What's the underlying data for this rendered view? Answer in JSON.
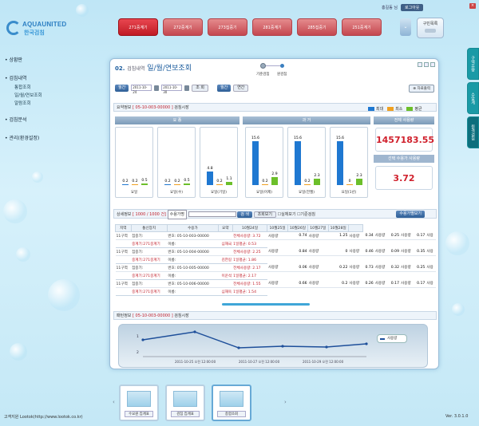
{
  "logo": {
    "line1": "AQUAUNITED",
    "line2": "한국검침"
  },
  "top_links": {
    "user": "홍길동 님",
    "logout": "로그아웃"
  },
  "top_tabs": [
    "271중계기",
    "272중계기",
    "273집중기",
    "281중계기",
    "285집중기",
    "251중계기"
  ],
  "menu_button": "구민목록",
  "nav": {
    "title1": "상황판",
    "title2": "검침내역",
    "sub": [
      "통합조회",
      "일/월/연보조회",
      "알람조회"
    ],
    "title3": "검침분석",
    "title4": "관리(환경설정)"
  },
  "right_tabs": [
    "구역유량",
    "수압계",
    "원격검침"
  ],
  "panel": {
    "title_num": "02.",
    "title_small": "검침내역",
    "title_main": "일/월/연보조회",
    "step1": "기준검침",
    "step2": "원검침",
    "filters": {
      "label": "월간",
      "from": "2011-10-24",
      "to": "2011-10-30",
      "search": "조 회",
      "tab1": "월간",
      "tab2": "연간"
    },
    "export": "자료출력",
    "summary_header": {
      "label": "요약정보",
      "code": "[ 05-10-003-00000 ]",
      "suffix": "검침시장"
    },
    "legend": [
      "최대",
      "최소",
      "평균"
    ],
    "section_labels": {
      "left": "요 종",
      "mid": "과 거",
      "right": "전체 사용량"
    },
    "total_usage": "1457183.55",
    "month_label": "선택 수용가 사용량",
    "month_value": "3.72",
    "detail_header": {
      "label": "상세정보",
      "count": "[ 1000 / 1000 건]",
      "filter": "수용가명",
      "btn": "검 색",
      "btn2": "조회보기",
      "check1": "실체보기",
      "check2": "기준검침",
      "list_btn": "수용가별보기"
    },
    "detail_cols": [
      "지역",
      "통신장치",
      "수용가",
      "요약",
      "10월24일",
      "10월25일",
      "10월26일",
      "10월27일",
      "10월28일",
      ""
    ],
    "detail_rows": [
      {
        "region": "11구역",
        "dev": [
          "집중기:",
          "중계기:271중계기"
        ],
        "cust": [
          "번호: 05-10-003-00000",
          "이름:"
        ],
        "name": "심재국",
        "sum": [
          "전체사용량: 3.72",
          "1일평균: 0.53"
        ],
        "v": [
          [
            "사용량",
            "0.74"
          ],
          [
            "사용량",
            "1.25"
          ],
          [
            "사용량",
            "0.34"
          ],
          [
            "사용량",
            "0.25"
          ],
          [
            "사용량",
            "0.17"
          ]
        ]
      },
      {
        "region": "11구역",
        "dev": [
          "집중기:",
          "중계기:271중계기"
        ],
        "cust": [
          "번호: 05-10-004-00000",
          "이름:"
        ],
        "name": "김한길",
        "sum": [
          "전체사용량: 2.25",
          "1일평균: 1.86"
        ],
        "v": [
          [
            "사용량",
            "0.84"
          ],
          [
            "사용량",
            "0"
          ],
          [
            "사용량",
            "0.46"
          ],
          [
            "사용량",
            "0.09"
          ],
          [
            "사용량",
            "0.35"
          ]
        ]
      },
      {
        "region": "11구역",
        "dev": [
          "집중기:",
          "중계기:271중계기"
        ],
        "cust": [
          "번호: 05-10-005-00000",
          "이름:"
        ],
        "name": "이운석",
        "sum": [
          "전체사용량: 2.17",
          "1일평균: 2.17"
        ],
        "v": [
          [
            "사용량",
            "0.06"
          ],
          [
            "사용량",
            "0.22"
          ],
          [
            "사용량",
            "0.73"
          ],
          [
            "사용량",
            "0.32"
          ],
          [
            "사용량",
            "0.25"
          ]
        ]
      },
      {
        "region": "11구역",
        "dev": [
          "집중기:",
          "중계기:271중계기"
        ],
        "cust": [
          "번호: 05-10-006-00000",
          "이름:"
        ],
        "name": "심재욱",
        "sum": [
          "전체사용량: 1.55",
          "1일평균: 1.54"
        ],
        "v": [
          [
            "사용량",
            "0.66"
          ],
          [
            "사용량",
            "0.2"
          ],
          [
            "사용량",
            "0.26"
          ],
          [
            "사용량",
            "0.17"
          ],
          [
            "사용량",
            "0.17"
          ]
        ]
      }
    ],
    "row_extra": "사용",
    "trend_header": {
      "label": "패턴정보",
      "code": "[ 05-10-003-00000 ]",
      "suffix": "검침시장"
    },
    "trend_legend": "사용량",
    "trend_x": [
      "2011-10-25 오전 12:00:00",
      "2011-10-27 오전 12:00:00",
      "2011-10-29 오전 12:00:00"
    ],
    "trend_y": [
      "1",
      "2"
    ]
  },
  "chart_data": {
    "type": "bar",
    "series_names": [
      "최대",
      "최소",
      "평균"
    ],
    "colors": {
      "max": "#1f78d1",
      "min": "#f0a020",
      "avg": "#6cbf2a"
    },
    "groups": [
      {
        "label": "요일",
        "values": [
          0.2,
          0.2,
          0.5
        ]
      },
      {
        "label": "요일(수)",
        "values": [
          0.2,
          0.2,
          0.5
        ]
      },
      {
        "label": "요일(기일)",
        "values": [
          4.8,
          0.2,
          1.1
        ]
      },
      {
        "label": "요일(어제)",
        "values": [
          15.6,
          0.2,
          2.9
        ]
      },
      {
        "label": "요일(전월)",
        "values": [
          15.6,
          0.2,
          2.3
        ]
      },
      {
        "label": "요일(1년)",
        "values": [
          15.6,
          0,
          2.3
        ]
      }
    ]
  },
  "footer": {
    "left": "고객지원 Lootok(http://www.lootok.co.kr)",
    "right": "Ver. 3.0.1.0"
  },
  "bottom_tabs": [
    "수요원 집계표",
    "검침 집계표",
    "종합조회"
  ]
}
